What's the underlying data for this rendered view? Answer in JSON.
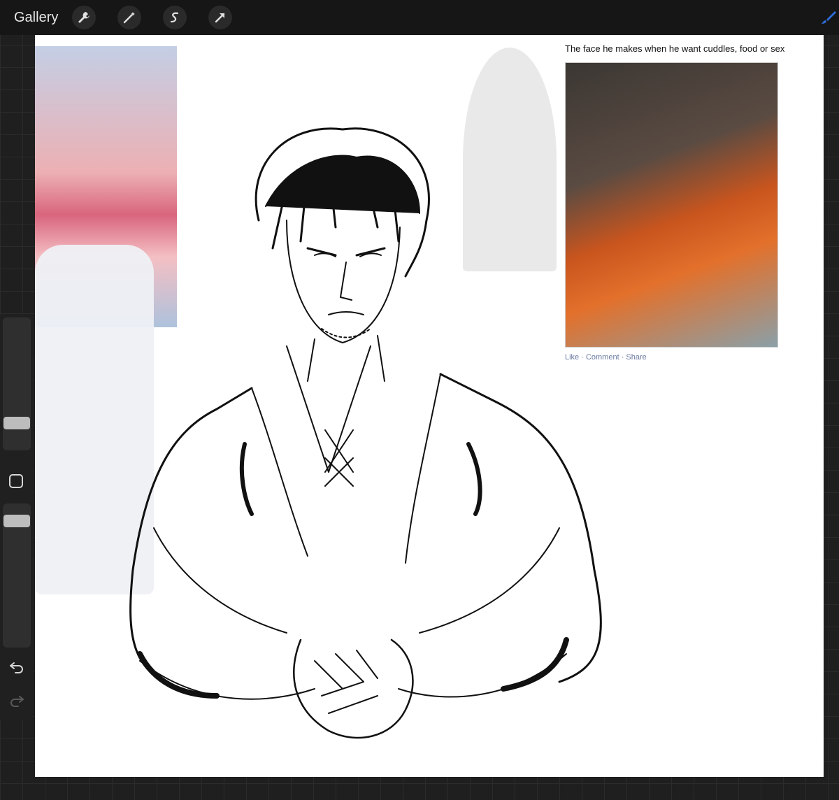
{
  "toolbar": {
    "gallery_label": "Gallery",
    "tools": [
      "wrench-icon",
      "magic-wand-icon",
      "selection-icon",
      "transform-arrow-icon"
    ],
    "active_tool": "brush-icon",
    "accent_color": "#2e6bd6"
  },
  "canvas": {
    "background": "#ffffff",
    "reference_post": {
      "caption": "The face he makes when he want cuddles, food or sex",
      "actions": "Like · Comment · Share"
    }
  },
  "sidebar": {
    "brush_size_level": 0.32,
    "opacity_level": 0.85,
    "modify_icon": "square-icon",
    "undo_icon": "undo-icon",
    "redo_icon": "redo-icon"
  }
}
